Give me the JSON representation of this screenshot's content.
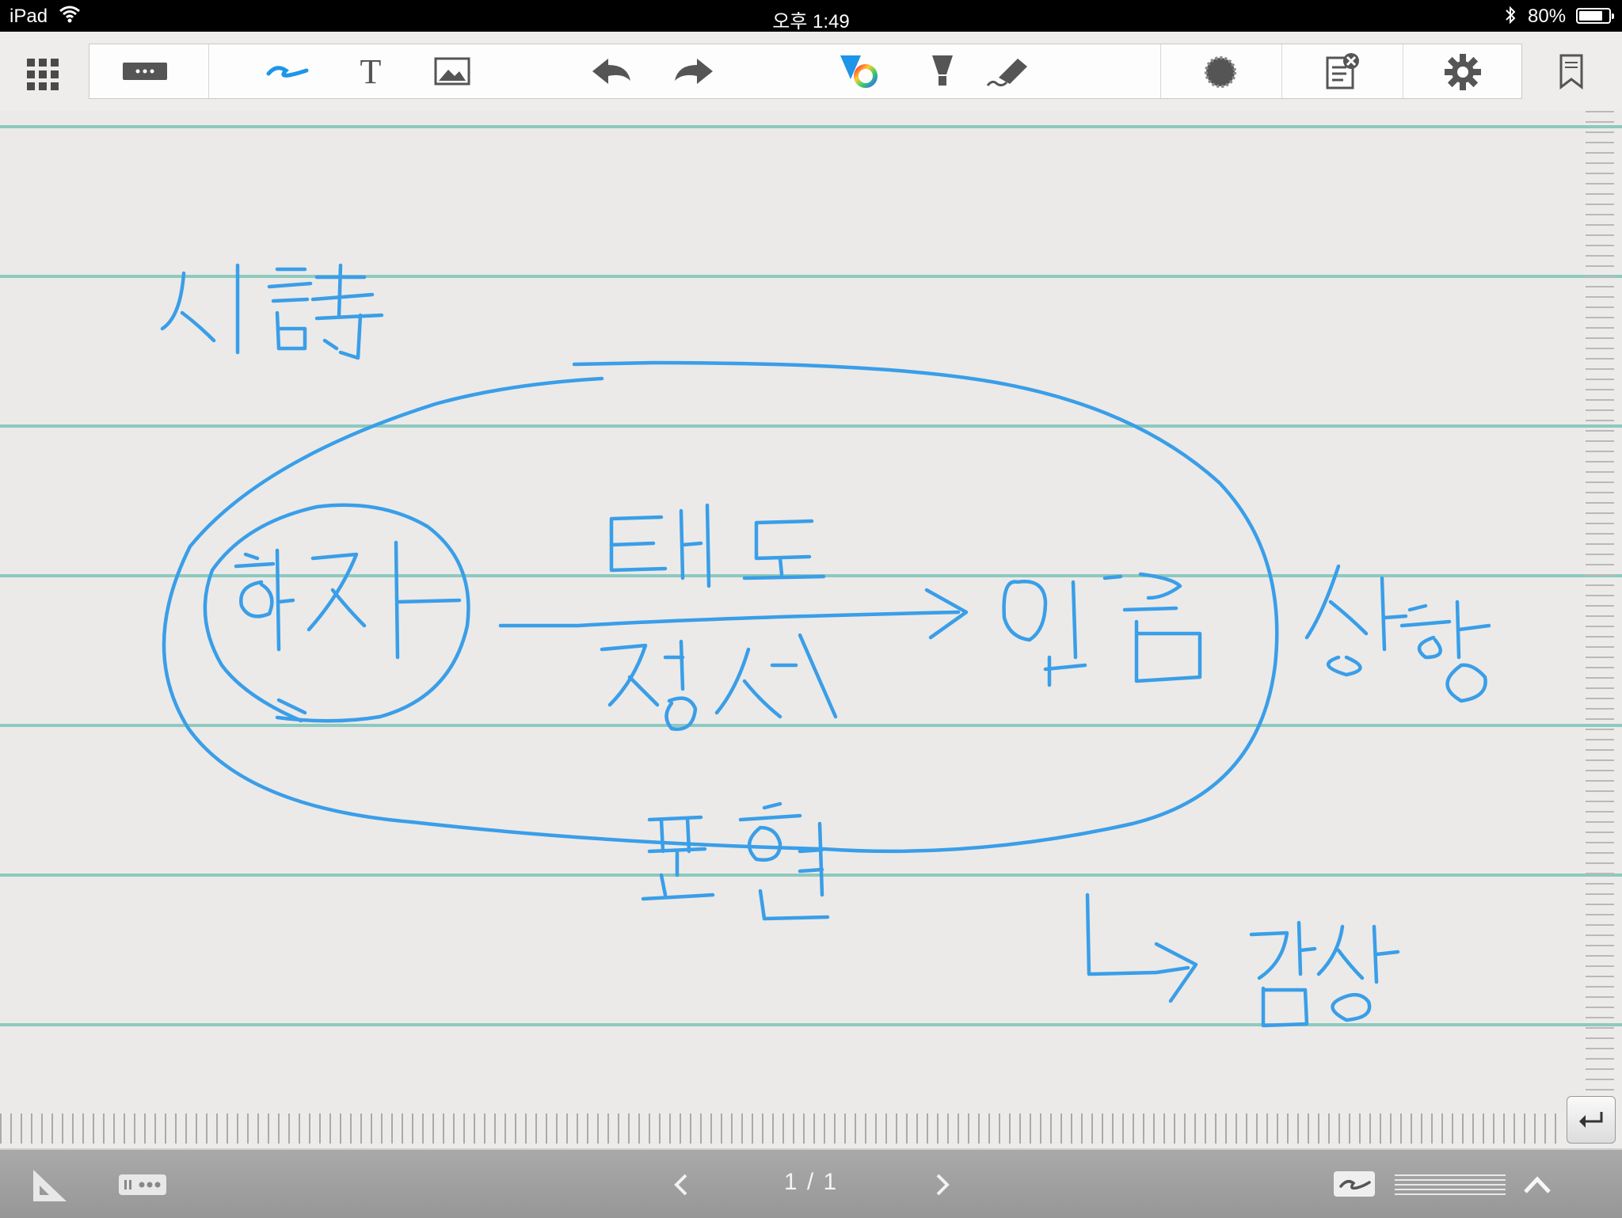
{
  "status_bar": {
    "device": "iPad",
    "wifi_icon": "wifi-icon",
    "time": "오후 1:49",
    "bluetooth_icon": "bluetooth-icon",
    "battery": "80%",
    "battery_level": 0.8
  },
  "toolbar": {
    "icons": [
      "grid-menu-icon",
      "keyboard-input-icon",
      "pen-tool-icon",
      "text-tool-icon",
      "image-tool-icon",
      "undo-icon",
      "redo-icon",
      "color-picker-icon",
      "highlighter-icon",
      "eraser-icon",
      "lasso-select-icon",
      "clear-page-icon",
      "settings-icon",
      "bookmark-icon"
    ],
    "text_tool_glyph": "T"
  },
  "canvas": {
    "ink_color": "#3a9ee8",
    "rule_color": "#8ec9bf",
    "handwriting": [
      "시 詩",
      "화자",
      "태도",
      "정서",
      "대상",
      "상황",
      "표현",
      "감상"
    ]
  },
  "bottom_bar": {
    "page_indicator": "1 / 1",
    "icons": [
      "ruler-triangle-icon",
      "keyboard-icon",
      "prev-page-icon",
      "next-page-icon",
      "pen-mode-icon",
      "line-spacing-icon",
      "expand-up-icon",
      "return-icon"
    ]
  }
}
